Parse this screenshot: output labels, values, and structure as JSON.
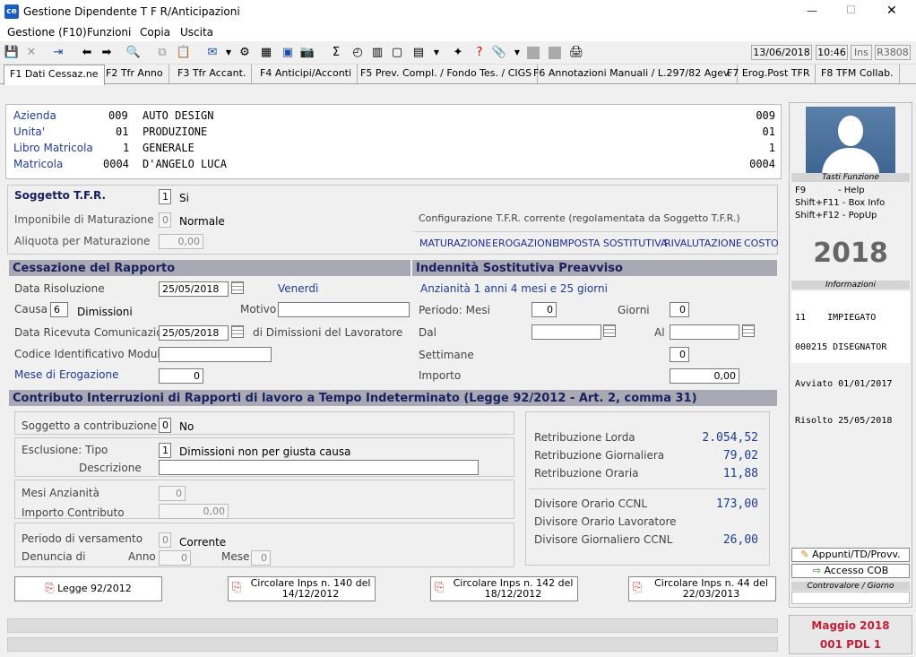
{
  "window": {
    "title": "Gestione Dipendente T F R/Anticipazioni",
    "minimize": "—",
    "maximize": "☐",
    "close": "✕",
    "app_icon": "ce"
  },
  "menu": [
    "Gestione (F10)",
    "Funzioni",
    "Copia",
    "Uscita"
  ],
  "status": {
    "date": "13/06/2018",
    "time": "10:46",
    "ins": "Ins",
    "code": "R3808"
  },
  "tabs": [
    "F1 Dati Cessaz.ne",
    "F2 Tfr Anno",
    "F3 Tfr Accant.",
    "F4 Anticipi/Acconti",
    "F5 Prev. Compl. / Fondo Tes. / CIGS",
    "F6 Annotazioni Manuali / L.297/82 Agev.",
    "F7 Erog.Post TFR",
    "F8 TFM Collab."
  ],
  "header": {
    "azienda": {
      "label": "Azienda",
      "code": "009",
      "name": "AUTO DESIGN",
      "right": "009"
    },
    "unita": {
      "label": "Unita'",
      "code": "01",
      "name": "PRODUZIONE",
      "right": "01"
    },
    "libro": {
      "label": "Libro Matricola",
      "code": "1",
      "name": "GENERALE",
      "right": "1"
    },
    "matricola": {
      "label": "Matricola",
      "code": "0004",
      "name": "D'ANGELO LUCA",
      "right": "0004"
    }
  },
  "tfr": {
    "soggetto_label": "Soggetto T.F.R.",
    "soggetto_value": "1",
    "soggetto_text": "Si",
    "imponibile_label": "Imponibile di Maturazione",
    "imponibile_value": "0",
    "imponibile_text": "Normale",
    "aliquota_label": "Aliquota per  Maturazione",
    "aliquota_value": "0,00",
    "config_label": "Configurazione T.F.R. corrente (regolamentata da Soggetto T.F.R.)",
    "links": [
      "MATURAZIONE",
      "EROGAZIONE",
      "IMPOSTA SOSTITUTIVA",
      "RIVALUTAZIONE",
      "COSTO"
    ]
  },
  "cessazione": {
    "title": "Cessazione del Rapporto",
    "data_ris_label": "Data Risoluzione",
    "data_ris": "25/05/2018",
    "giorno": "Venerdì",
    "causa_label": "Causa",
    "causa_value": "6",
    "causa_text": "Dimissioni",
    "motivo_label": "Motivo",
    "motivo_value": "",
    "data_ric_label": "Data Ricevuta Comunicazione",
    "data_ric": "25/05/2018",
    "data_ric_suffix": "di Dimissioni del Lavoratore",
    "codice_label": "Codice Identificativo Modulo",
    "codice_value": "",
    "mese_label": "Mese di Erogazione",
    "mese_value": "0"
  },
  "indennita": {
    "title": "Indennità Sostitutiva Preavviso",
    "anzianita": "Anzianità 1 anni 4 mesi e 25 giorni",
    "periodo_label": "Periodo: Mesi",
    "mesi": "0",
    "giorni_label": "Giorni",
    "giorni": "0",
    "dal_label": "Dal",
    "dal": "",
    "al_label": "Al",
    "al": "",
    "settimane_label": "Settimane",
    "settimane": "0",
    "importo_label": "Importo",
    "importo": "0,00"
  },
  "contributo": {
    "title": "Contributo Interruzioni di Rapporti di lavoro a Tempo Indeterminato (Legge 92/2012 - Art. 2, comma 31)",
    "soggetto_label": "Soggetto a contribuzione",
    "soggetto_value": "0",
    "soggetto_text": "No",
    "esclusione_label": "Esclusione: Tipo",
    "esclusione_value": "1",
    "esclusione_text": "Dimissioni non per giusta causa",
    "descrizione_label": "Descrizione",
    "descrizione_value": "",
    "mesi_label": "Mesi Anzianità",
    "mesi_value": "0",
    "importo_label": "Importo Contributo",
    "importo_value": "0,00",
    "periodo_label": "Periodo di versamento",
    "periodo_value": "0",
    "periodo_text": "Corrente",
    "denuncia_label": "Denuncia di",
    "anno_label": "Anno",
    "anno_value": "0",
    "mese_label": "Mese",
    "mese_value": "0"
  },
  "retribuzione": {
    "lorda_label": "Retribuzione Lorda",
    "lorda": "2.054,52",
    "giorn_label": "Retribuzione Giornaliera",
    "giorn": "79,02",
    "oraria_label": "Retribuzione Oraria",
    "oraria": "11,88",
    "div_ccnl_label": "Divisore Orario CCNL",
    "div_ccnl": "173,00",
    "div_lav_label": "Divisore Orario Lavoratore",
    "div_lav": "",
    "div_gg_label": "Divisore Giornaliero CCNL",
    "div_gg": "26,00"
  },
  "buttons": [
    "Legge 92/2012",
    "Circolare Inps n. 140 del 14/12/2012",
    "Circolare Inps n. 142 del 18/12/2012",
    "Circolare Inps n.  44 del 22/03/2013"
  ],
  "side": {
    "tasti_title": "Tasti Funzione",
    "keys": [
      {
        "k": "F9",
        "v": "- Help"
      },
      {
        "k": "Shift+F11",
        "v": "- Box Info"
      },
      {
        "k": "Shift+F12",
        "v": "- PopUp"
      }
    ],
    "year": "2018",
    "info_title": "Informazioni",
    "info_line1": "11    IMPIEGATO",
    "info_line2": "000215 DISEGNATOR",
    "avviato": "Avviato 01/01/2017",
    "risolto": "Risolto 25/05/2018",
    "appunti": "Appunti/TD/Provv.",
    "cob": "Accesso COB",
    "controvalore": "Controvalore / Giorno",
    "period": "Maggio   2018",
    "pdl": "001 PDL 1"
  }
}
